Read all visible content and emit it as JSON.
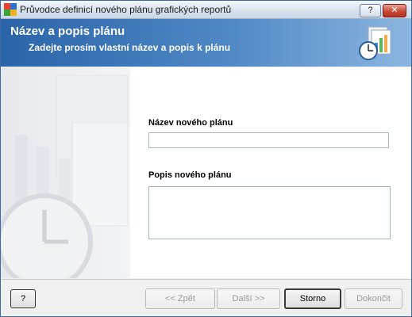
{
  "window": {
    "title": "Průvodce definicí nového plánu grafických reportů",
    "help_button": "?",
    "close_button": "✕"
  },
  "header": {
    "title": "Název a popis plánu",
    "subtitle": "Zadejte prosím vlastní název a popis k plánu",
    "colors": {
      "gradient_start": "#2b64a8",
      "gradient_end": "#8bb6e0"
    }
  },
  "form": {
    "name_label": "Název nového plánu",
    "name_value": "",
    "description_label": "Popis nového plánu",
    "description_value": ""
  },
  "footer": {
    "help_label": "?",
    "back_label": "<< Zpět",
    "next_label": "Další >>",
    "cancel_label": "Storno",
    "finish_label": "Dokončit"
  }
}
